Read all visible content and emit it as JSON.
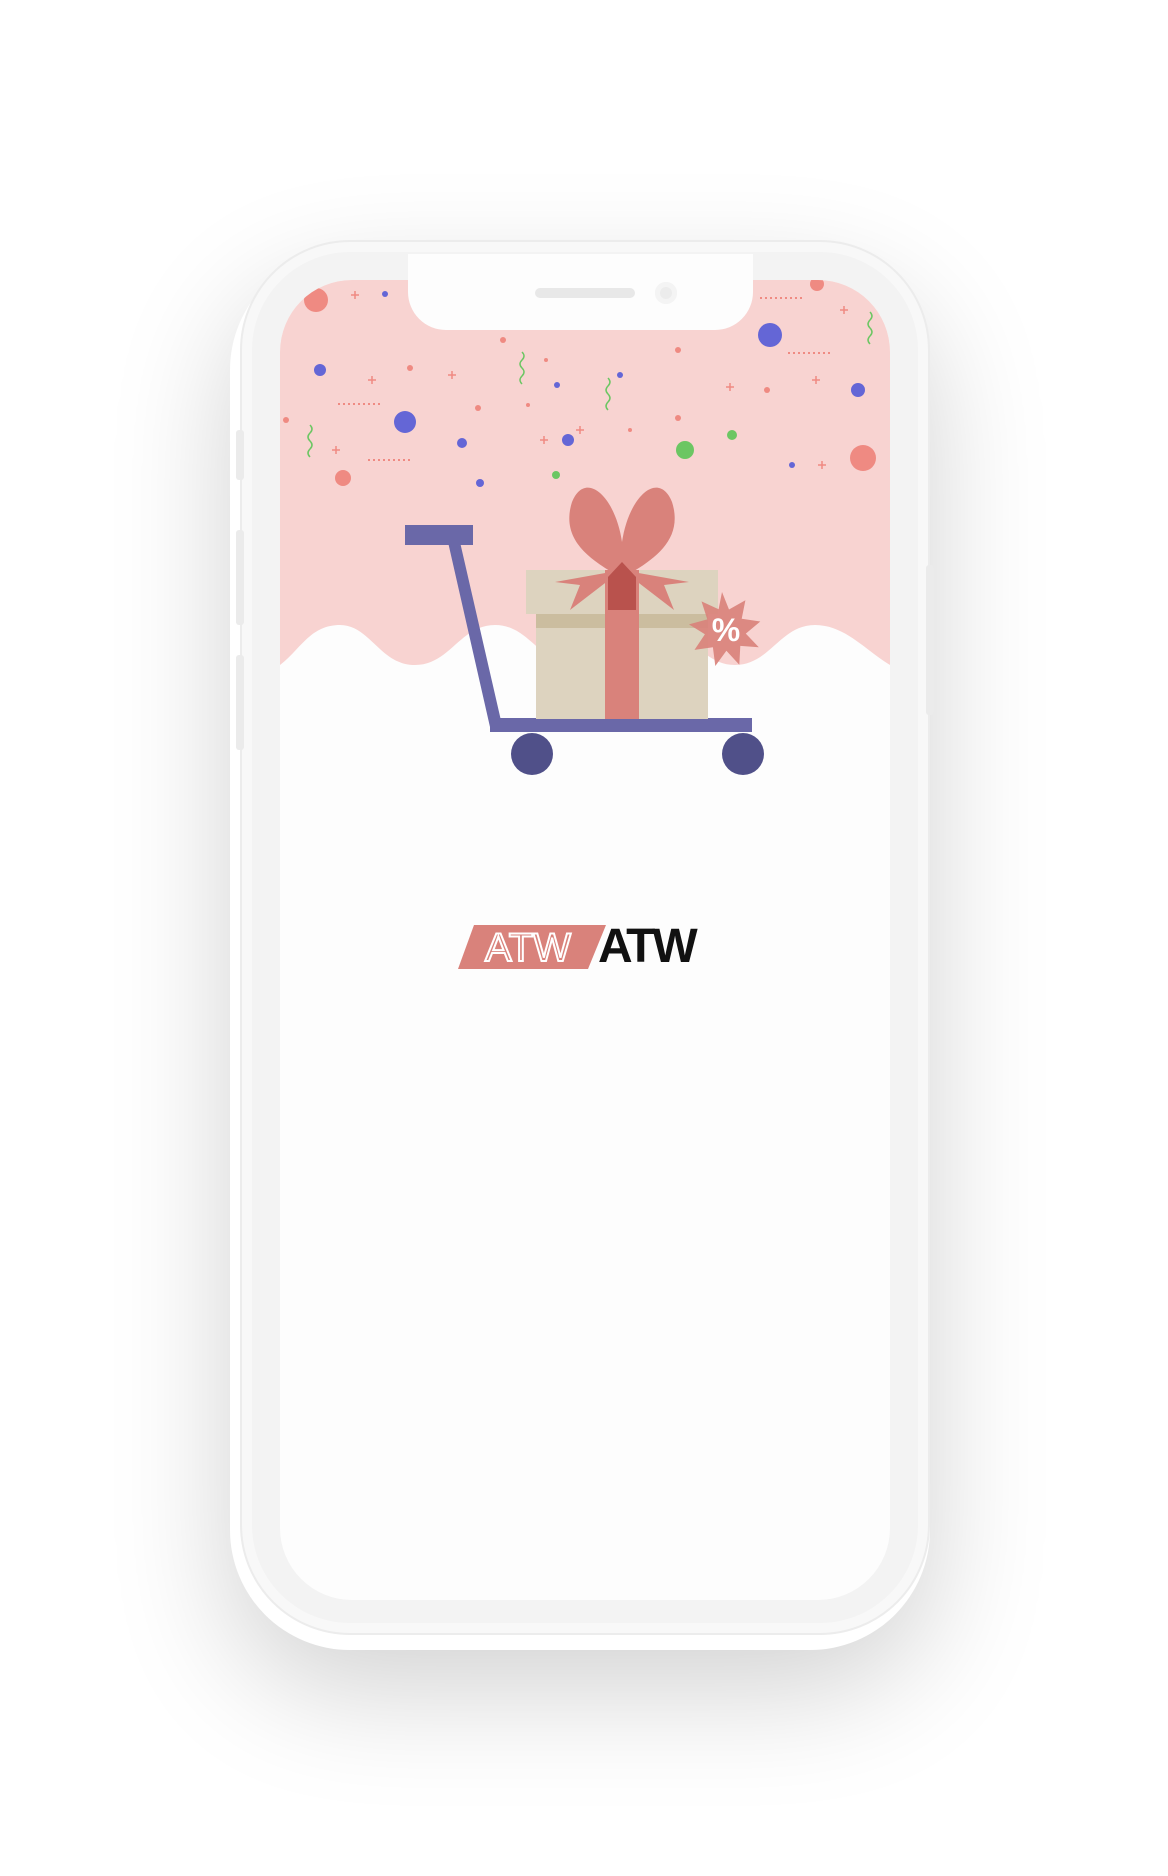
{
  "app": {
    "logo_text": "ATW",
    "logo_badge_text": "ATW",
    "promo_badge": "%"
  },
  "colors": {
    "header_bg": "#f8d3d1",
    "accent": "#d9827b",
    "cart": "#6a68a8",
    "cart_wheel": "#505089",
    "box": "#ddd3bf",
    "confetti_blue": "#6466d6",
    "confetti_green": "#6cc663"
  },
  "icons": {
    "illustration": "shopping-cart-gift-illustration",
    "badge": "discount-percent-badge-icon"
  }
}
